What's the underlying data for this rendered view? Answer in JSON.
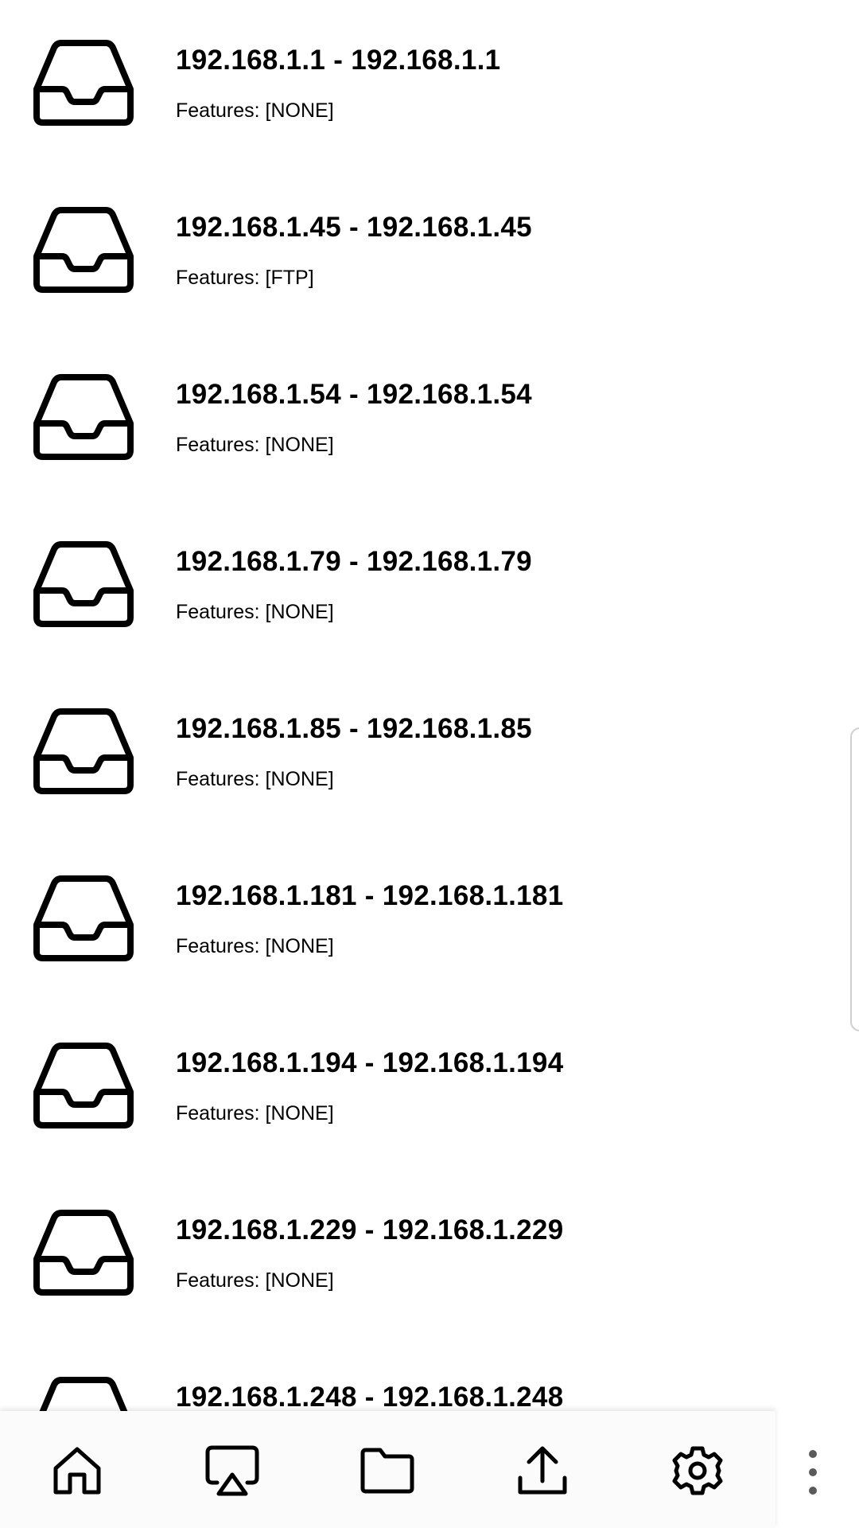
{
  "devices": [
    {
      "title": "192.168.1.1 - 192.168.1.1",
      "features": "Features: [NONE]"
    },
    {
      "title": "192.168.1.45 - 192.168.1.45",
      "features": "Features: [FTP]"
    },
    {
      "title": "192.168.1.54 - 192.168.1.54",
      "features": "Features: [NONE]"
    },
    {
      "title": "192.168.1.79 - 192.168.1.79",
      "features": "Features: [NONE]"
    },
    {
      "title": "192.168.1.85 - 192.168.1.85",
      "features": "Features: [NONE]"
    },
    {
      "title": "192.168.1.181 - 192.168.1.181",
      "features": "Features: [NONE]"
    },
    {
      "title": "192.168.1.194 - 192.168.1.194",
      "features": "Features: [NONE]"
    },
    {
      "title": "192.168.1.229 - 192.168.1.229",
      "features": "Features: [NONE]"
    },
    {
      "title": "192.168.1.248 - 192.168.1.248",
      "features": ""
    }
  ],
  "device_icon": "inbox-icon",
  "bottom_nav": {
    "items": [
      {
        "icon": "home-icon"
      },
      {
        "icon": "cast-icon"
      },
      {
        "icon": "folder-icon"
      },
      {
        "icon": "upload-icon"
      },
      {
        "icon": "gear-icon"
      }
    ],
    "overflow_icon": "more-vertical-icon"
  },
  "colors": {
    "background": "#ffffff",
    "text": "#000000",
    "nav_background": "#fbfbfb",
    "overflow_dots": "#5a5a5a"
  }
}
